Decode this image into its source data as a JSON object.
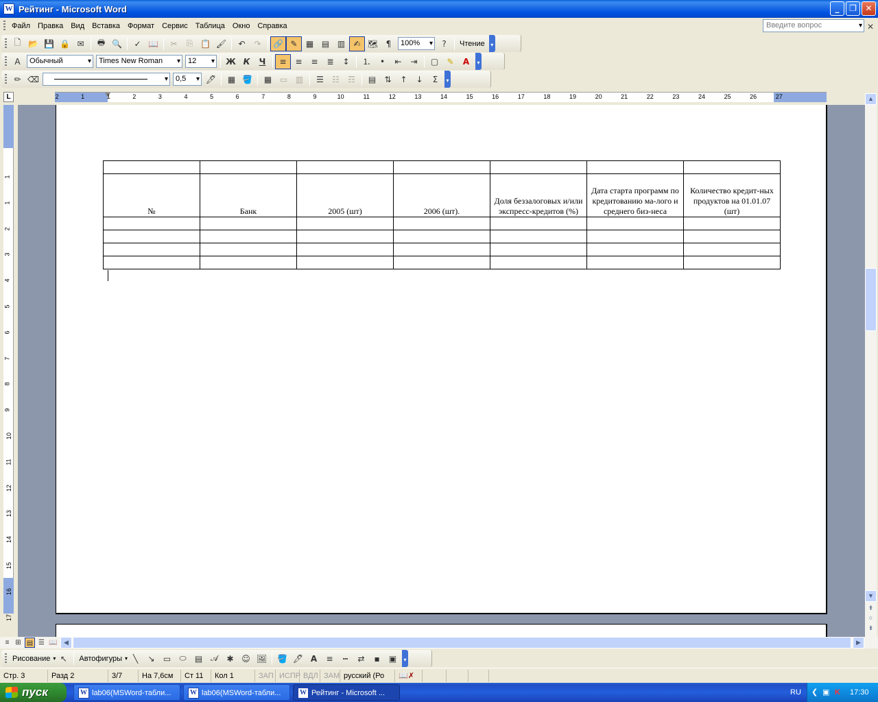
{
  "window": {
    "title": "Рейтинг - Microsoft Word",
    "app_letter": "W"
  },
  "menu": {
    "items": [
      "Файл",
      "Правка",
      "Вид",
      "Вставка",
      "Формат",
      "Сервис",
      "Таблица",
      "Окно",
      "Справка"
    ],
    "ask_placeholder": "Введите вопрос"
  },
  "standard_toolbar": {
    "zoom": "100%",
    "reading_label": "Чтение"
  },
  "format_toolbar": {
    "style": "Обычный",
    "font": "Times New Roman",
    "size": "12",
    "bold": "Ж",
    "italic": "К",
    "underline": "Ч"
  },
  "tables_toolbar": {
    "line_weight": "0,5"
  },
  "ruler": {
    "h_numbers": [
      "2",
      "1",
      "1",
      "2",
      "3",
      "4",
      "5",
      "6",
      "7",
      "8",
      "9",
      "10",
      "11",
      "12",
      "13",
      "14",
      "15",
      "16",
      "17",
      "18",
      "19",
      "20",
      "21",
      "22",
      "23",
      "24",
      "25",
      "26",
      "27"
    ],
    "v_numbers": [
      "1",
      "1",
      "2",
      "3",
      "4",
      "5",
      "6",
      "7",
      "8",
      "9",
      "10",
      "11",
      "12",
      "13",
      "14",
      "15",
      "16",
      "17"
    ]
  },
  "document": {
    "table": {
      "header": [
        "№",
        "Банк",
        "2005 (шт)",
        "2006 (шт).",
        "Доля беззалоговых и/или экспресс-кредитов (%)",
        "Дата старта программ по кредитованию ма-лого и среднего биз-неса",
        "Количество кредит-ных продуктов на 01.01.07 (шт)"
      ],
      "empty_rows_after": 4,
      "empty_rows_before": 1
    }
  },
  "drawing_toolbar": {
    "drawing_label": "Рисование",
    "autoshapes_label": "Автофигуры"
  },
  "status": {
    "page": "Стр. 3",
    "section": "Разд 2",
    "pages": "3/7",
    "at": "На 7,6см",
    "line": "Ст 11",
    "col": "Кол 1",
    "rec": "ЗАП",
    "trk": "ИСПР",
    "ext": "ВДЛ",
    "ovr": "ЗАМ",
    "language": "русский (Ро"
  },
  "taskbar": {
    "start_label": "пуск",
    "tasks": [
      "lab06(MSWord-табли...",
      "lab06(MSWord-табли...",
      "Рейтинг - Microsoft ..."
    ],
    "lang": "RU",
    "clock": "17:30"
  }
}
